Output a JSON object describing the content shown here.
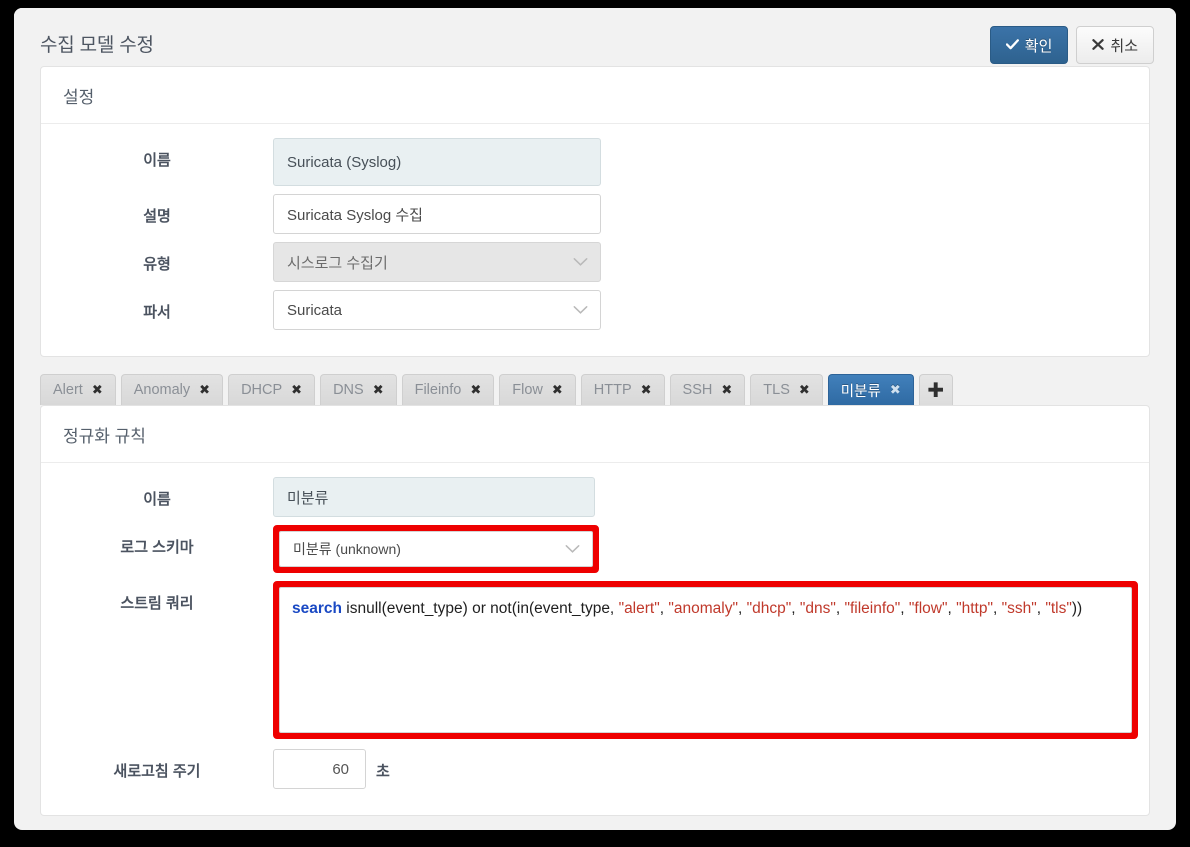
{
  "dialog": {
    "title": "수집 모델 수정",
    "confirm_label": "확인",
    "cancel_label": "취소",
    "confirm_icon": "check-icon",
    "cancel_icon": "times-icon"
  },
  "settings_panel": {
    "heading": "설정",
    "fields": {
      "name": {
        "label": "이름",
        "value": "Suricata (Syslog)",
        "readonly": true
      },
      "description": {
        "label": "설명",
        "value": "Suricata Syslog 수집",
        "readonly": false
      },
      "type": {
        "label": "유형",
        "value": "시스로그 수집기",
        "disabled": true
      },
      "parser": {
        "label": "파서",
        "value": "Suricata",
        "disabled": false
      }
    }
  },
  "tabs": {
    "items": [
      {
        "label": "Alert",
        "active": false
      },
      {
        "label": "Anomaly",
        "active": false
      },
      {
        "label": "DHCP",
        "active": false
      },
      {
        "label": "DNS",
        "active": false
      },
      {
        "label": "Fileinfo",
        "active": false
      },
      {
        "label": "Flow",
        "active": false
      },
      {
        "label": "HTTP",
        "active": false
      },
      {
        "label": "SSH",
        "active": false
      },
      {
        "label": "TLS",
        "active": false
      },
      {
        "label": "미분류",
        "active": true
      }
    ],
    "close_glyph": "✖",
    "add_glyph": "✚",
    "active_color": "#3674ad"
  },
  "rules_panel": {
    "heading": "정규화 규칙",
    "fields": {
      "name": {
        "label": "이름",
        "value": "미분류",
        "readonly": true
      },
      "log_schema": {
        "label": "로그 스키마",
        "value": "미분류 (unknown)",
        "highlighted": true
      },
      "stream_query": {
        "label": "스트림 쿼리",
        "highlighted": true,
        "keyword": "search",
        "text_after_keyword": " isnull(event_type) or not(in(event_type, ",
        "string_args": [
          "\"alert\"",
          "\"anomaly\"",
          "\"dhcp\"",
          "\"dns\"",
          "\"fileinfo\"",
          "\"flow\"",
          "\"http\"",
          "\"ssh\"",
          "\"tls\""
        ],
        "tail": "))",
        "full_value": "search isnull(event_type) or not(in(event_type, \"alert\", \"anomaly\", \"dhcp\", \"dns\", \"fileinfo\", \"flow\", \"http\", \"ssh\", \"tls\"))"
      },
      "refresh_interval": {
        "label": "새로고침 주기",
        "value": "60",
        "unit": "초"
      }
    }
  },
  "colors": {
    "accent_blue": "#3674ad",
    "highlight_red": "#ee0000",
    "query_keyword": "#1a49c4",
    "query_string": "#c0392b"
  }
}
